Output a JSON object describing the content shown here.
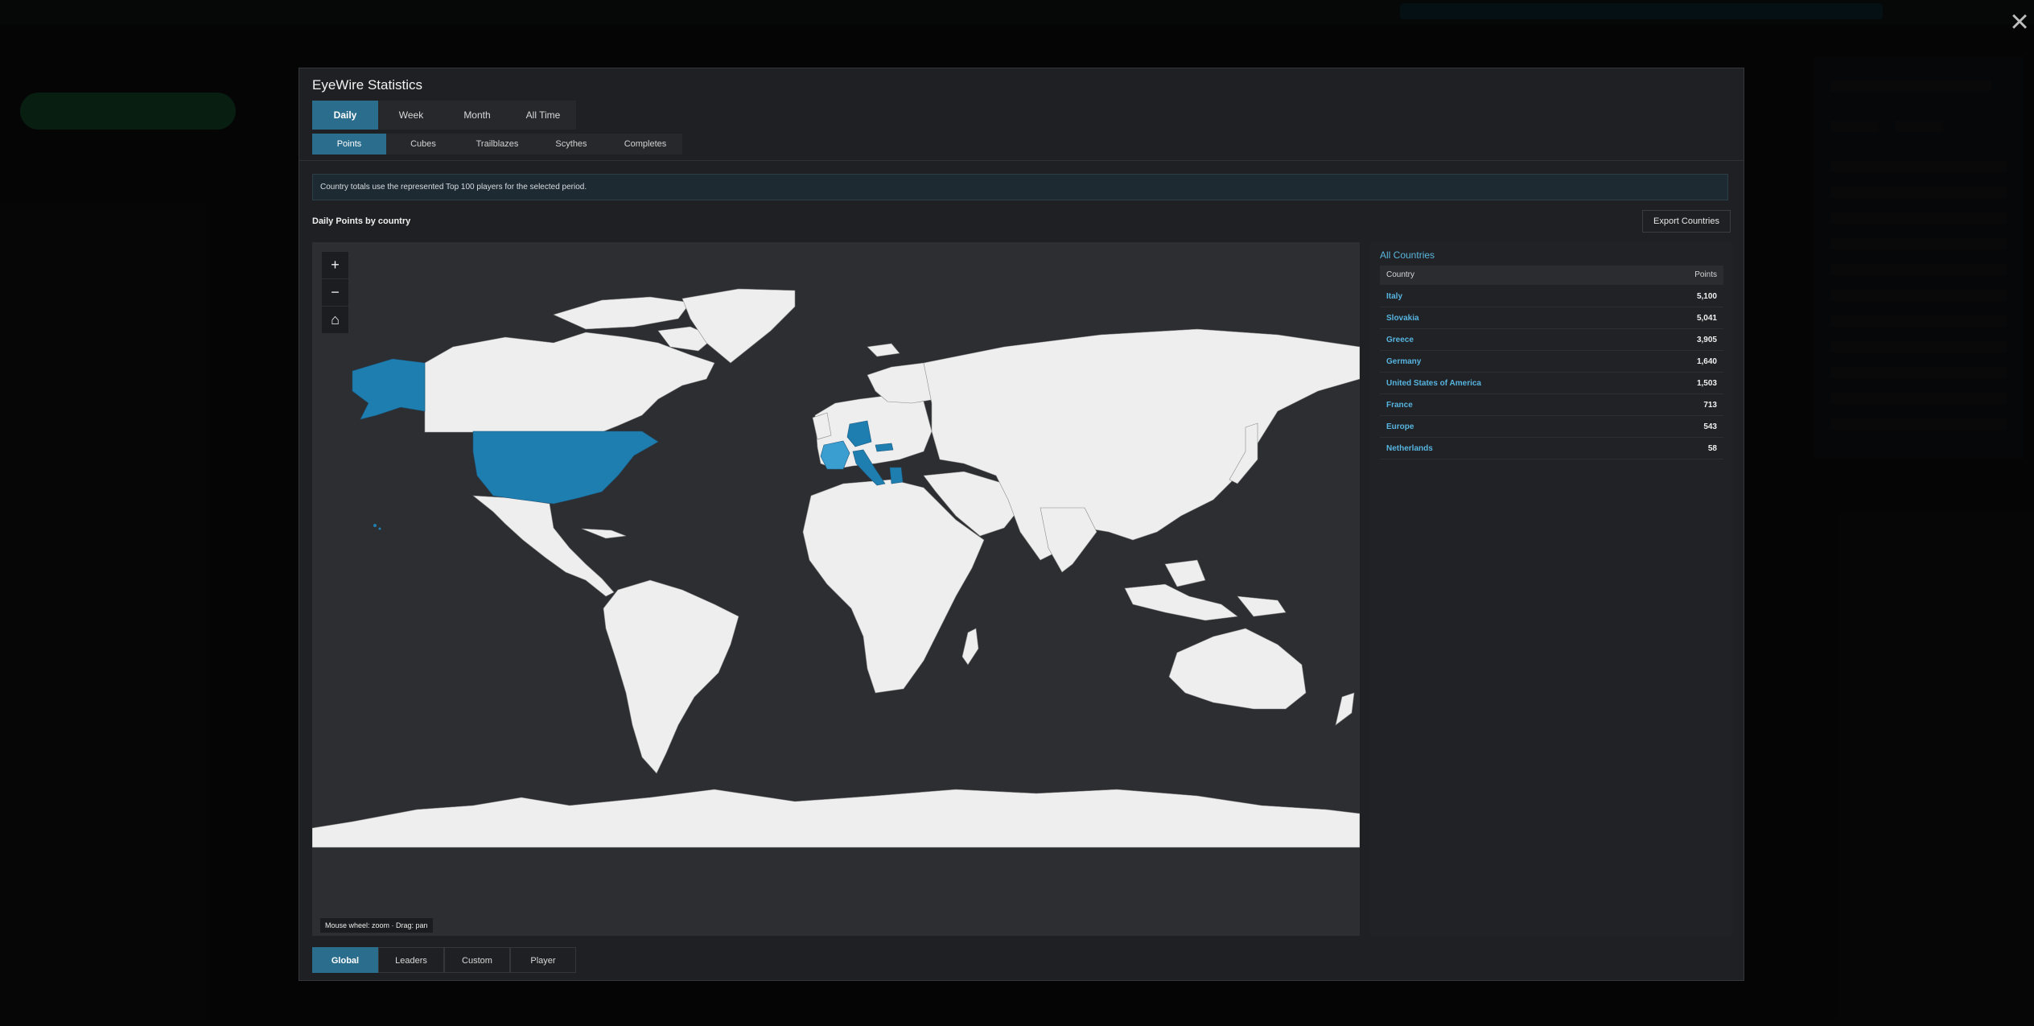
{
  "modal": {
    "title": "EyeWire Statistics",
    "period_tabs": [
      {
        "label": "Daily",
        "active": true
      },
      {
        "label": "Week",
        "active": false
      },
      {
        "label": "Month",
        "active": false
      },
      {
        "label": "All Time",
        "active": false
      }
    ],
    "metric_tabs": [
      {
        "label": "Points",
        "active": true
      },
      {
        "label": "Cubes",
        "active": false
      },
      {
        "label": "Trailblazes",
        "active": false
      },
      {
        "label": "Scythes",
        "active": false
      },
      {
        "label": "Completes",
        "active": false
      }
    ],
    "notice": "Country totals use the represented Top 100 players for the selected period.",
    "section_title": "Daily Points by country",
    "export_label": "Export Countries",
    "map": {
      "zoom_in": "+",
      "zoom_out": "−",
      "home": "⌂",
      "hint": "Mouse wheel: zoom · Drag: pan",
      "highlight_color": "#1f7eb0",
      "highlight_light": "#3a9fd0",
      "land_color": "#eeeeee",
      "ocean_color": "#2d2e32"
    },
    "table": {
      "heading": "All Countries",
      "col_country": "Country",
      "col_points": "Points",
      "rows": [
        {
          "country": "Italy",
          "points": "5,100"
        },
        {
          "country": "Slovakia",
          "points": "5,041"
        },
        {
          "country": "Greece",
          "points": "3,905"
        },
        {
          "country": "Germany",
          "points": "1,640"
        },
        {
          "country": "United States of America",
          "points": "1,503"
        },
        {
          "country": "France",
          "points": "713"
        },
        {
          "country": "Europe",
          "points": "543"
        },
        {
          "country": "Netherlands",
          "points": "58"
        }
      ]
    },
    "bottom_tabs": [
      {
        "label": "Global",
        "active": true
      },
      {
        "label": "Leaders",
        "active": false
      },
      {
        "label": "Custom",
        "active": false
      },
      {
        "label": "Player",
        "active": false
      }
    ]
  },
  "close_icon": "×",
  "accent": "#2b6d8d",
  "link_color": "#57b4df"
}
